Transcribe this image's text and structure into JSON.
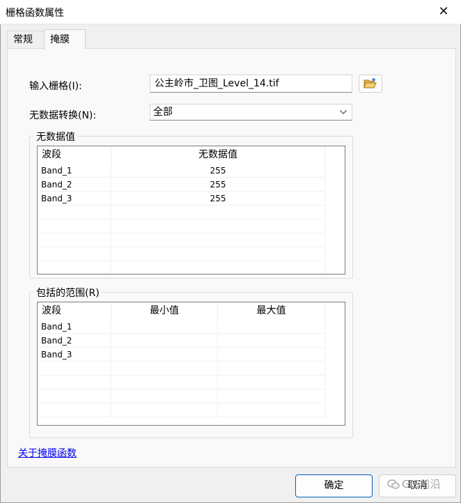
{
  "window": {
    "title": "栅格函数属性",
    "close_glyph": "✕"
  },
  "tabs": [
    {
      "label": "常规"
    },
    {
      "label": "掩膜"
    }
  ],
  "input_raster": {
    "label": "输入栅格(I):",
    "value": "公主岭市_卫图_Level_14.tif"
  },
  "nodata_conversion": {
    "label": "无数据转换(N):",
    "selected": "全部"
  },
  "nodata_group": {
    "title": "无数据值",
    "columns": [
      "波段",
      "无数据值"
    ],
    "rows": [
      {
        "band": "Band_1",
        "value": "255"
      },
      {
        "band": "Band_2",
        "value": "255"
      },
      {
        "band": "Band_3",
        "value": "255"
      }
    ]
  },
  "range_group": {
    "title": "包括的范围(R)",
    "columns": [
      "波段",
      "最小值",
      "最大值"
    ],
    "rows": [
      {
        "band": "Band_1",
        "min": "",
        "max": ""
      },
      {
        "band": "Band_2",
        "min": "",
        "max": ""
      },
      {
        "band": "Band_3",
        "min": "",
        "max": ""
      }
    ]
  },
  "footer": {
    "help_link": "关于掩膜函数",
    "ok_label": "确定",
    "cancel_label": "取消",
    "watermark": "GIS前沿"
  },
  "icons": {
    "browse": "open-folder-icon",
    "dropdown": "chevron-down-icon",
    "close": "close-icon"
  }
}
